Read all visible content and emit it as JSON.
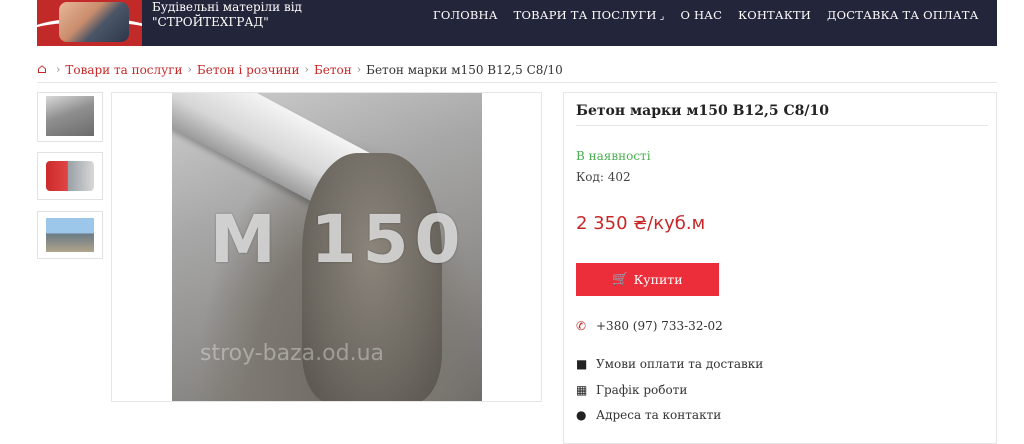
{
  "header": {
    "brand_line1": "Будівельні матеріли від",
    "brand_line2": "\"СТРОЙТЕХГРАД\"",
    "nav": [
      {
        "label": "ГОЛОВНА"
      },
      {
        "label": "ТОВАРИ ТА ПОСЛУГИ"
      },
      {
        "label": "О НАС"
      },
      {
        "label": "КОНТАКТИ"
      },
      {
        "label": "ДОСТАВКА ТА ОПЛАТА"
      }
    ]
  },
  "breadcrumb": {
    "items": [
      "Товари та послуги",
      "Бетон і розчини",
      "Бетон"
    ],
    "current": "Бетон марки м150 В12,5 С8/10"
  },
  "image": {
    "overlay_text": "М 150",
    "watermark": "stroy-baza.od.ua"
  },
  "product": {
    "title": "Бетон марки м150 В12,5 С8/10",
    "stock": "В наявності",
    "code": "Код: 402",
    "price": "2 350 ₴/куб.м",
    "buy_label": "Купити",
    "phone": "+380 (97) 733-32-02",
    "payment_delivery": "Умови оплати та доставки",
    "schedule": "Графік роботи",
    "address": "Адреса та контакти"
  },
  "colors": {
    "header_bg": "#23253a",
    "accent": "#c62828",
    "button": "#ec2e3a",
    "in_stock": "#4caf50"
  }
}
